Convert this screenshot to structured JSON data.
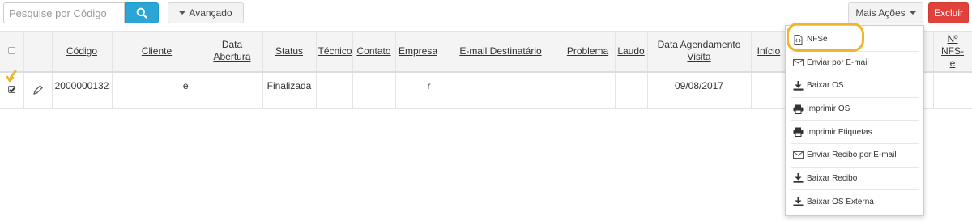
{
  "toolbar": {
    "search_placeholder": "Pesquise por Código",
    "search_icon": "search-icon",
    "advanced_label": "Avançado",
    "more_actions_label": "Mais Ações",
    "delete_label": "Excluir"
  },
  "colors": {
    "search_button": "#2aa5d6",
    "delete_button": "#e0413a",
    "highlight": "#f2b52a"
  },
  "table": {
    "headers": {
      "codigo": "Código",
      "cliente": "Cliente",
      "data_abertura": "Data Abertura",
      "status": "Status",
      "tecnico": "Técnico",
      "contato": "Contato",
      "empresa": "Empresa",
      "email": "E-mail Destinatário",
      "problema": "Problema",
      "laudo": "Laudo",
      "data_agendamento": "Data Agendamento Visita",
      "inicio": "Início",
      "nfse": "Nº NFS-e"
    },
    "rows": [
      {
        "codigo": "2000000132",
        "cliente": "e",
        "data_abertura": "",
        "status": "Finalizada",
        "tecnico": "",
        "contato": "",
        "empresa": "r",
        "email": "",
        "problema": "",
        "laudo": "",
        "data_agendamento": "09/08/2017",
        "inicio": "",
        "nfse": ""
      }
    ]
  },
  "more_actions_menu": {
    "items": [
      {
        "label": "NFSe",
        "icon": "file-code-icon"
      },
      {
        "label": "Enviar por E-mail",
        "icon": "envelope-icon"
      },
      {
        "label": "Baixar OS",
        "icon": "download-icon"
      },
      {
        "label": "Imprimir OS",
        "icon": "printer-icon"
      },
      {
        "label": "Imprimir Etiquetas",
        "icon": "printer-icon"
      },
      {
        "label": "Enviar Recibo por E-mail",
        "icon": "envelope-icon"
      },
      {
        "label": "Baixar Recibo",
        "icon": "download-icon"
      },
      {
        "label": "Baixar OS Externa",
        "icon": "download-icon"
      }
    ]
  }
}
